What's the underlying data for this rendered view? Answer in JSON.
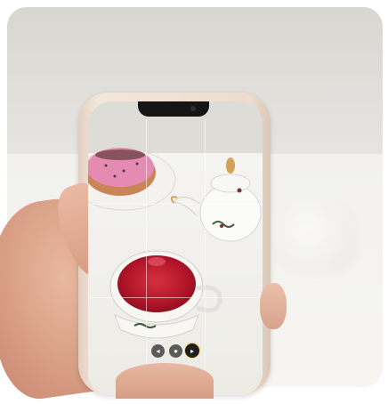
{
  "photo": {
    "subject": "hand-holding-phone-photographing-tea",
    "colors": {
      "phone_frame": "#efe0d3",
      "tea": "#c01e2a",
      "donut_icing": "#e07fa8",
      "background": "#ecebe7"
    }
  },
  "camera_app": {
    "zoom_options": [
      {
        "label": "0.5",
        "icon": "zoom-wide-icon",
        "selected": false
      },
      {
        "label": "1",
        "icon": "zoom-normal-icon",
        "selected": false
      },
      {
        "label": "2",
        "icon": "zoom-tele-icon",
        "selected": true
      }
    ],
    "grid_enabled": true
  }
}
